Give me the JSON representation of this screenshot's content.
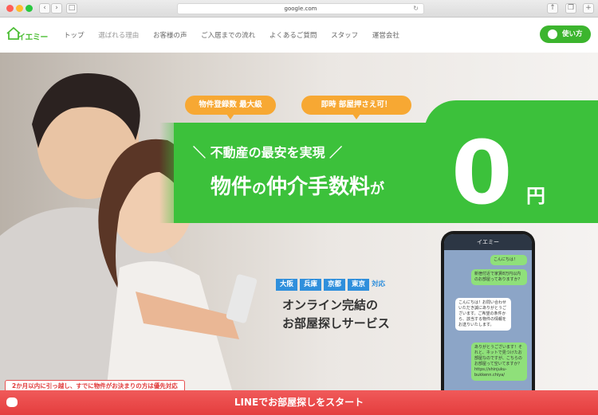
{
  "browser": {
    "url": "google.com"
  },
  "header": {
    "logo_text": "イエミー",
    "nav": [
      "トップ",
      "選ばれる理由",
      "お客様の声",
      "ご入居までの流れ",
      "よくあるご質問",
      "スタッフ",
      "運営会社"
    ],
    "howto_label": "使い方"
  },
  "hero": {
    "pill_left": "物件登録数 最大級",
    "pill_right": "即時 部屋押さえ可！",
    "headline_small": "＼ 不動産の最安を実現 ／",
    "headline_part1": "物件",
    "headline_no1": "の",
    "headline_part2": "仲介手数料",
    "headline_ga": "が",
    "zero": "0",
    "yen": "円",
    "cities": [
      "大阪",
      "兵庫",
      "京都",
      "東京"
    ],
    "taio": "対応",
    "service_line1": "オンライン完結の",
    "service_line2": "お部屋探しサービス"
  },
  "phone": {
    "title": "イエミー",
    "messages": [
      "こんにちは！",
      "新宿付近で家賃8万円以内のお部屋ってありますか？",
      "こんにちは！お問い合わせいただき誠にありがとうございます。ご希望の条件から、該当する物件の情報をお送りいたします。",
      "ありがとうございます！それと、ネットで見つけたお部屋なのですが、こちらのお部屋って空いてますか？ https://shinjuku-bukkenn.chiya/"
    ]
  },
  "notice": "2か月以内に引っ越し、すでに物件がお決まりの方は優先対応",
  "cta": "LINEでお部屋探しをスタート",
  "colors": {
    "brand_green": "#3cc13b",
    "accent_orange": "#f7a833",
    "cta_red": "#e84848",
    "city_blue": "#2f8fdc"
  }
}
